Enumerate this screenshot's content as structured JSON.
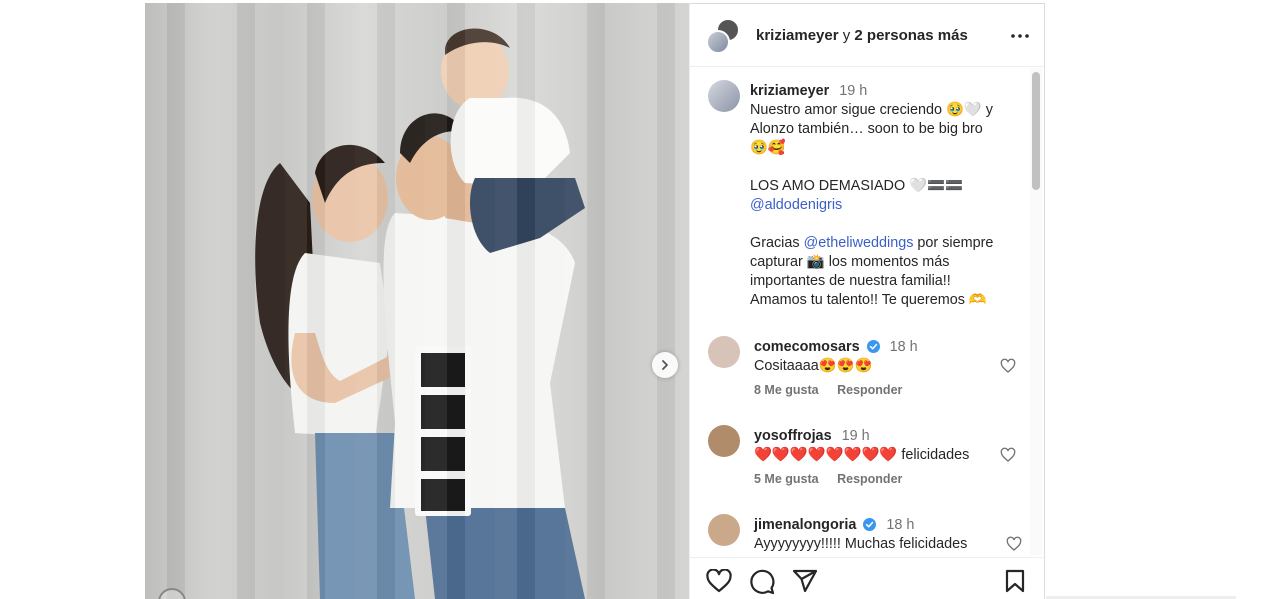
{
  "post": {
    "header": {
      "username": "kriziameyer",
      "connector": "y",
      "others": "2 personas más"
    },
    "caption": {
      "username": "kriziameyer",
      "time": "19 h",
      "lines": [
        "Nuestro amor sigue creciendo 🥹🤍 y",
        "Alonzo también… soon to be big bro",
        "🥹🥰"
      ],
      "line_love": "LOS AMO DEMASIADO 🤍🟰🟰",
      "mention1": "@aldodenigris",
      "thanks_prefix": "Gracias",
      "mention2": "@etheliweddings",
      "thanks_suffix": "por siempre",
      "lines2": [
        "capturar 📸 los momentos más",
        "importantes de nuestra familia!!",
        "Amamos tu talento!! Te queremos 🫶"
      ]
    },
    "comments": [
      {
        "username": "comecomosars",
        "verified": true,
        "time": "18 h",
        "text": "Cositaaaa😍😍😍",
        "likes": "8 Me gusta",
        "reply": "Responder",
        "avatar_color": "#d8c3b8"
      },
      {
        "username": "yosoffrojas",
        "verified": false,
        "time": "19 h",
        "text": "❤️❤️❤️❤️❤️❤️❤️❤️ felicidades",
        "likes": "5 Me gusta",
        "reply": "Responder",
        "avatar_color": "#b08c6a"
      },
      {
        "username": "jimenalongoria",
        "verified": true,
        "time": "18 h",
        "text": "Ayyyyyyyy!!!!! Muchas felicidades",
        "likes": "",
        "reply": "",
        "avatar_color": "#c9a98a"
      }
    ],
    "icons": {
      "like": "heart-icon",
      "comment": "comment-icon",
      "share": "share-icon",
      "save": "bookmark-icon",
      "more": "more-options-icon",
      "next": "chevron-right-icon"
    },
    "colors": {
      "mention": "#3a5fc9",
      "verified": "#3897f0",
      "muted": "#737373"
    }
  }
}
